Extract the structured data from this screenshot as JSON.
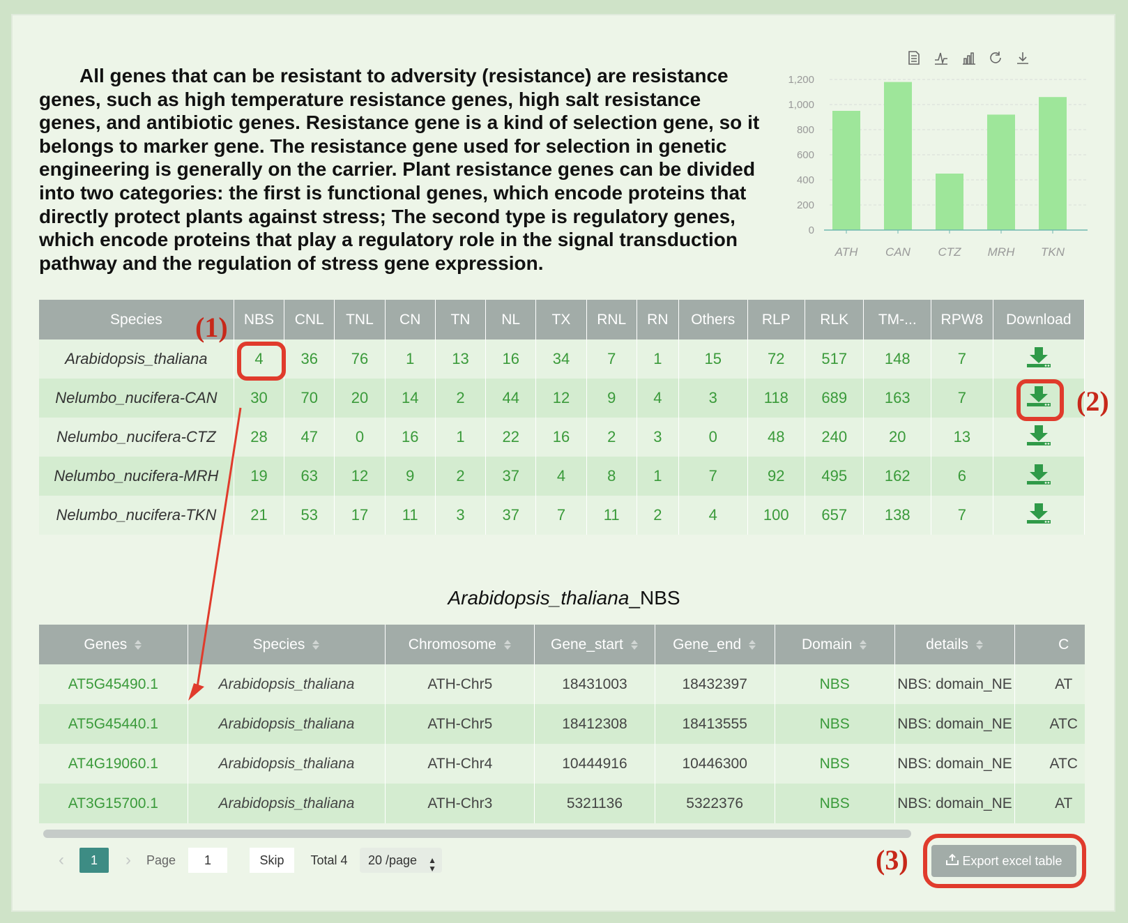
{
  "intro_text": "All genes that can be resistant to adversity (resistance) are resistance genes, such as high temperature resistance genes, high salt resistance genes, and antibiotic genes. Resistance gene is a kind of selection gene, so it belongs to marker gene. The resistance gene used for selection in genetic engineering is generally on the carrier. Plant resistance genes can be divided into two categories: the first is functional genes, which encode proteins that directly protect plants against stress; The second type is regulatory genes, which encode proteins that play a regulatory role in the signal transduction pathway and the regulation of stress gene expression.",
  "chart_toolbar": [
    "data-view-icon",
    "line-chart-icon",
    "bar-chart-icon",
    "refresh-icon",
    "download-icon"
  ],
  "chart_data": {
    "type": "bar",
    "categories": [
      "ATH",
      "CAN",
      "CTZ",
      "MRH",
      "TKN"
    ],
    "values": [
      950,
      1180,
      450,
      920,
      1060
    ],
    "yticks": [
      "0",
      "200",
      "400",
      "600",
      "800",
      "1,000",
      "1,200"
    ],
    "ylim": [
      0,
      1200
    ],
    "color": "#9ee69a"
  },
  "summary_table": {
    "headers": [
      "Species",
      "NBS",
      "CNL",
      "TNL",
      "CN",
      "TN",
      "NL",
      "TX",
      "RNL",
      "RN",
      "Others",
      "RLP",
      "RLK",
      "TM-...",
      "RPW8",
      "Download"
    ],
    "rows": [
      [
        "Arabidopsis_thaliana",
        "4",
        "36",
        "76",
        "1",
        "13",
        "16",
        "34",
        "7",
        "1",
        "15",
        "72",
        "517",
        "148",
        "7"
      ],
      [
        "Nelumbo_nucifera-CAN",
        "30",
        "70",
        "20",
        "14",
        "2",
        "44",
        "12",
        "9",
        "4",
        "3",
        "118",
        "689",
        "163",
        "7"
      ],
      [
        "Nelumbo_nucifera-CTZ",
        "28",
        "47",
        "0",
        "16",
        "1",
        "22",
        "16",
        "2",
        "3",
        "0",
        "48",
        "240",
        "20",
        "13"
      ],
      [
        "Nelumbo_nucifera-MRH",
        "19",
        "63",
        "12",
        "9",
        "2",
        "37",
        "4",
        "8",
        "1",
        "7",
        "92",
        "495",
        "162",
        "6"
      ],
      [
        "Nelumbo_nucifera-TKN",
        "21",
        "53",
        "17",
        "11",
        "3",
        "37",
        "7",
        "11",
        "2",
        "4",
        "100",
        "657",
        "138",
        "7"
      ]
    ]
  },
  "detail": {
    "title_species": "Arabidopsis_thaliana",
    "title_suffix": "_NBS",
    "headers": [
      "Genes",
      "Species",
      "Chromosome",
      "Gene_start",
      "Gene_end",
      "Domain",
      "details",
      "C"
    ],
    "rows": [
      [
        "AT5G45490.1",
        "Arabidopsis_thaliana",
        "ATH-Chr5",
        "18431003",
        "18432397",
        "NBS",
        "NBS: domain_NE",
        "AT"
      ],
      [
        "AT5G45440.1",
        "Arabidopsis_thaliana",
        "ATH-Chr5",
        "18412308",
        "18413555",
        "NBS",
        "NBS: domain_NE",
        "ATC"
      ],
      [
        "AT4G19060.1",
        "Arabidopsis_thaliana",
        "ATH-Chr4",
        "10444916",
        "10446300",
        "NBS",
        "NBS: domain_NE",
        "ATC"
      ],
      [
        "AT3G15700.1",
        "Arabidopsis_thaliana",
        "ATH-Chr3",
        "5321136",
        "5322376",
        "NBS",
        "NBS: domain_NE",
        "AT"
      ]
    ]
  },
  "pager": {
    "current_page": "1",
    "page_label": "Page",
    "page_input": "1",
    "skip_label": "Skip",
    "total_label": "Total 4",
    "page_size": "20 /page",
    "export_label": "Export excel table"
  },
  "annotations": [
    "(1)",
    "(2)",
    "(3)"
  ]
}
